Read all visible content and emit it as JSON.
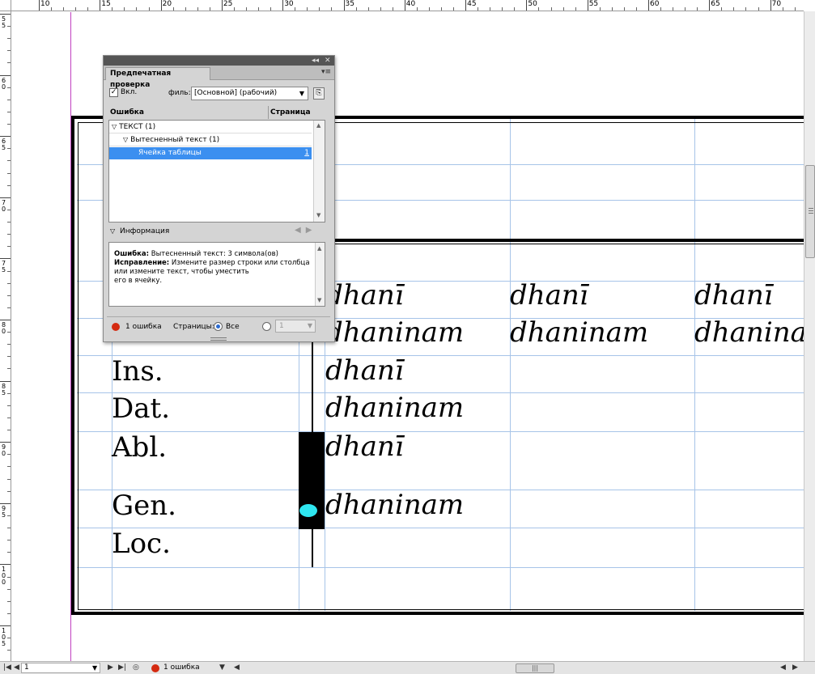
{
  "ruler": {
    "top_labels": [
      "10",
      "15",
      "20",
      "25",
      "30",
      "35",
      "40",
      "45",
      "50",
      "55",
      "60",
      "65",
      "70"
    ],
    "left_labels": [
      "55",
      "60",
      "65",
      "70",
      "75",
      "80",
      "85",
      "90",
      "95",
      "100",
      "105"
    ]
  },
  "table": {
    "cases": [
      "Ins.",
      "Dat.",
      "Abl.",
      "Gen.",
      "Loc."
    ],
    "forms_row1": [
      "dhanī",
      "dhanī",
      "dhanī"
    ],
    "forms_row2": [
      "dhaninam",
      "dhaninam",
      "dhanina"
    ],
    "forms_col": [
      "dhanī",
      "dhaninam",
      "dhanī",
      "dhaninam"
    ],
    "overset_marker_color": "#2fe6f0"
  },
  "preflight": {
    "title": "Предпечатная проверка",
    "menu_icon": "panel-menu-icon",
    "on_checked": true,
    "on_label": "Вкл.",
    "profile_label": "филь:",
    "profile_value": "[Основной] (рабочий)",
    "col_error": "Ошибка",
    "col_page": "Страница",
    "tree": [
      {
        "label": "ТЕКСТ (1)",
        "level": 0,
        "page": ""
      },
      {
        "label": "Вытесненный текст (1)",
        "level": 1,
        "page": ""
      },
      {
        "label": "Ячейка таблицы",
        "level": 2,
        "page": "1",
        "selected": true
      }
    ],
    "info_label": "Информация",
    "info_error_key": "Ошибка:",
    "info_error_text": "Вытесненный текст: 3 символа(ов)",
    "info_fix_key": "Исправление:",
    "info_fix_text": "Измените размер строки или столбца",
    "info_fix_text2": "или измените текст, чтобы уместить",
    "info_fix_text3": "его в ячейку.",
    "footer_errors": "1 ошибка",
    "footer_pages_label": "Страницы:",
    "footer_all": "Все",
    "footer_range": "1",
    "error_color": "#d42a10"
  },
  "statusbar": {
    "page_value": "1",
    "errors": "1 ошибка"
  }
}
